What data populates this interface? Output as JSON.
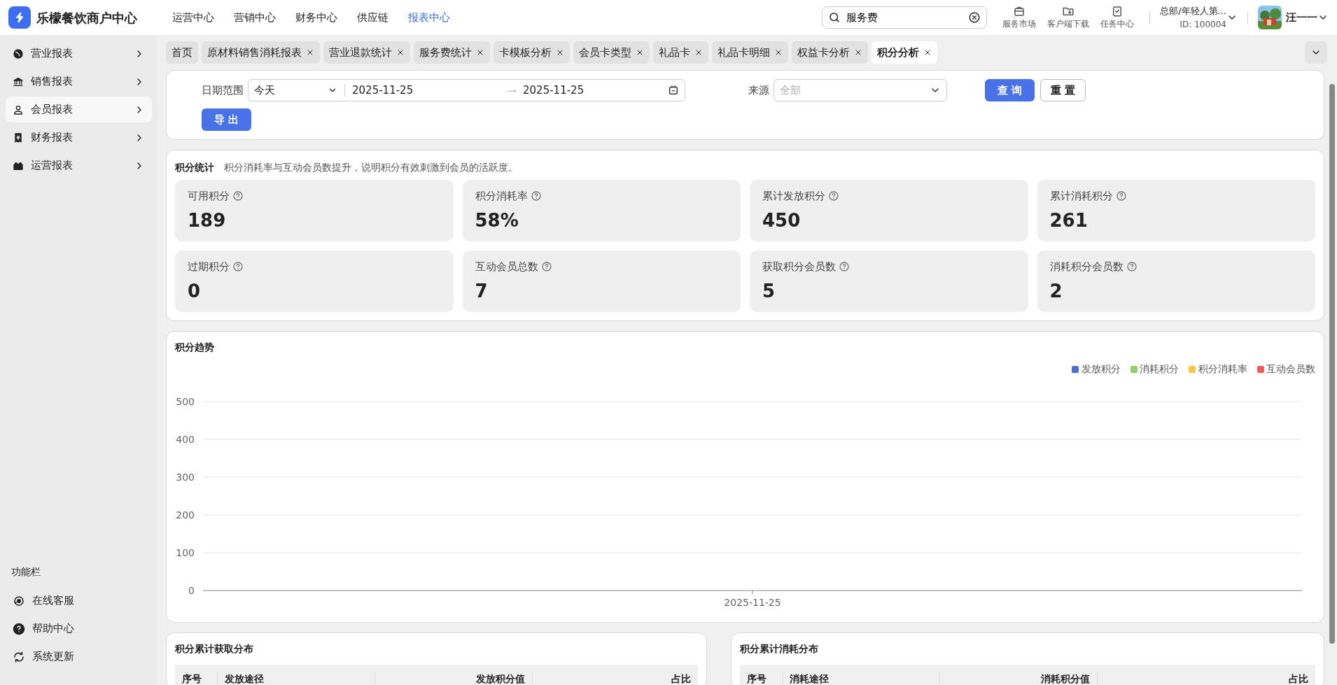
{
  "brand": {
    "title": "乐檬餐饮商户中心"
  },
  "top_nav": [
    {
      "label": "运营中心",
      "selected": false
    },
    {
      "label": "营销中心",
      "selected": false
    },
    {
      "label": "财务中心",
      "selected": false
    },
    {
      "label": "供应链",
      "selected": false
    },
    {
      "label": "报表中心",
      "selected": true
    }
  ],
  "search": {
    "value": "服务费"
  },
  "top_tools": [
    {
      "kind": "bag",
      "label": "服务市场"
    },
    {
      "kind": "download",
      "label": "客户端下载"
    },
    {
      "kind": "task",
      "label": "任务中心"
    }
  ],
  "store": {
    "name": "总部/年轻人第...",
    "id": "ID: 100004"
  },
  "user": {
    "name": "汪一一"
  },
  "sidebar": {
    "items": [
      {
        "kind": "globe",
        "label": "营业报表",
        "selected": false
      },
      {
        "kind": "bank",
        "label": "销售报表",
        "selected": false
      },
      {
        "kind": "person",
        "label": "会员报表",
        "selected": true
      },
      {
        "kind": "receipt",
        "label": "财务报表",
        "selected": false
      },
      {
        "kind": "shop",
        "label": "运营报表",
        "selected": false
      }
    ],
    "footer_title": "功能栏",
    "footer_items": [
      {
        "kind": "service",
        "label": "在线客服"
      },
      {
        "kind": "help",
        "label": "帮助中心"
      },
      {
        "kind": "refresh",
        "label": "系统更新"
      }
    ]
  },
  "tabs": [
    {
      "label": "首页",
      "closable": false,
      "selected": false
    },
    {
      "label": "原材料销售消耗报表",
      "closable": true,
      "selected": false
    },
    {
      "label": "营业退款统计",
      "closable": true,
      "selected": false
    },
    {
      "label": "服务费统计",
      "closable": true,
      "selected": false
    },
    {
      "label": "卡模板分析",
      "closable": true,
      "selected": false
    },
    {
      "label": "会员卡类型",
      "closable": true,
      "selected": false
    },
    {
      "label": "礼品卡",
      "closable": true,
      "selected": false
    },
    {
      "label": "礼品卡明细",
      "closable": true,
      "selected": false
    },
    {
      "label": "权益卡分析",
      "closable": true,
      "selected": false
    },
    {
      "label": "积分分析",
      "closable": true,
      "selected": true
    }
  ],
  "filters": {
    "date_label": "日期范围",
    "date_preset": "今天",
    "date_start": "2025-11-25",
    "date_end": "2025-11-25",
    "source_label": "来源",
    "source_placeholder": "全部",
    "query_button": "查 询",
    "reset_button": "重 置",
    "export_button": "导 出"
  },
  "stats": {
    "title": "积分统计",
    "description": "积分消耗率与互动会员数提升，说明积分有效刺激到会员的活跃度。",
    "items": [
      {
        "label": "可用积分",
        "value": "189"
      },
      {
        "label": "积分消耗率",
        "value": "58%"
      },
      {
        "label": "累计发放积分",
        "value": "450"
      },
      {
        "label": "累计消耗积分",
        "value": "261"
      },
      {
        "label": "过期积分",
        "value": "0"
      },
      {
        "label": "互动会员总数",
        "value": "7"
      },
      {
        "label": "获取积分会员数",
        "value": "5"
      },
      {
        "label": "消耗积分会员数",
        "value": "2"
      }
    ]
  },
  "trend": {
    "title": "积分趋势",
    "chart_data": {
      "type": "line",
      "grid": true,
      "categories": [
        "2025-11-25"
      ],
      "ylim": [
        0,
        500
      ],
      "yticks": [
        0,
        100,
        200,
        300,
        400,
        500
      ],
      "series": [
        {
          "name": "发放积分",
          "color": "#4a6fd6",
          "values": [
            null
          ]
        },
        {
          "name": "消耗积分",
          "color": "#8fd16a",
          "values": [
            null
          ]
        },
        {
          "name": "积分消耗率",
          "color": "#f7c843",
          "values": [
            null
          ]
        },
        {
          "name": "互动会员数",
          "color": "#ee5b5b",
          "values": [
            null
          ]
        }
      ]
    }
  },
  "tables": [
    {
      "title": "积分累计获取分布",
      "columns": [
        "序号",
        "发放途径",
        "发放积分值",
        "占比"
      ]
    },
    {
      "title": "积分累计消耗分布",
      "columns": [
        "序号",
        "消耗途径",
        "消耗积分值",
        "占比"
      ]
    }
  ]
}
